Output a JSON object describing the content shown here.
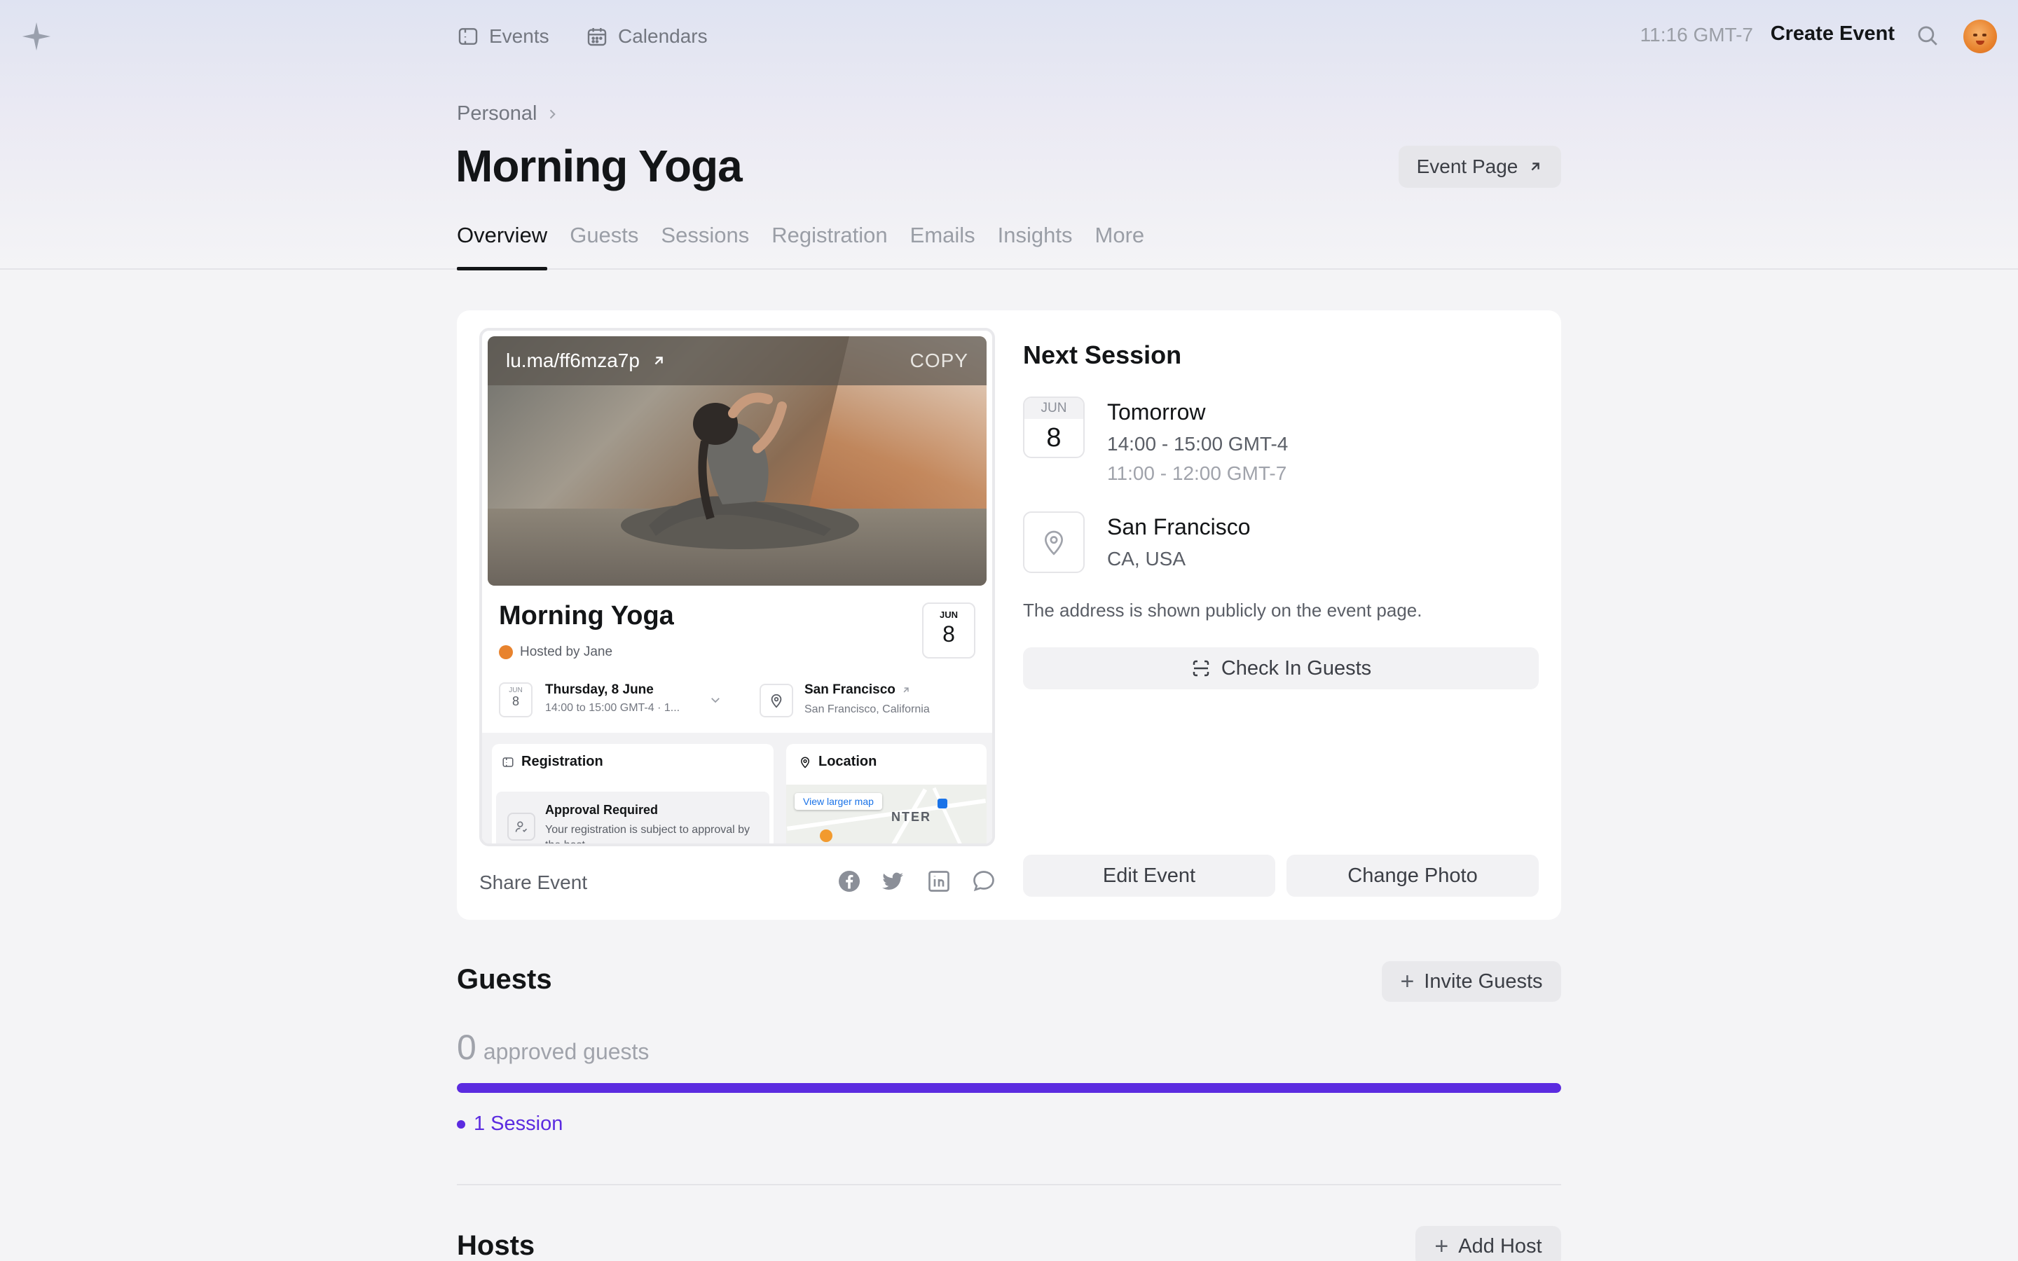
{
  "nav": {
    "events_label": "Events",
    "calendars_label": "Calendars",
    "time": "11:16 GMT-7",
    "create_event_label": "Create Event"
  },
  "header": {
    "breadcrumb": "Personal",
    "title": "Morning Yoga",
    "event_page_label": "Event Page",
    "tabs": [
      {
        "label": "Overview",
        "active": true
      },
      {
        "label": "Guests"
      },
      {
        "label": "Sessions"
      },
      {
        "label": "Registration"
      },
      {
        "label": "Emails"
      },
      {
        "label": "Insights"
      },
      {
        "label": "More"
      }
    ]
  },
  "preview": {
    "link": "lu.ma/ff6mza7p",
    "copy_label": "COPY",
    "title": "Morning Yoga",
    "host": "Hosted by Jane",
    "cal_month": "JUN",
    "cal_day": "8",
    "date_main": "Thursday, 8 June",
    "date_sub": "14:00 to 15:00 GMT-4 · 1...",
    "location_main": "San Francisco",
    "location_sub": "San Francisco, California",
    "registration_head": "Registration",
    "approval_title": "Approval Required",
    "approval_sub": "Your registration is subject to approval by the host.",
    "location_head": "Location",
    "map_button": "View larger map",
    "map_label": "NTER"
  },
  "share": {
    "label": "Share Event",
    "icons": [
      "facebook-icon",
      "twitter-icon",
      "linkedin-icon",
      "message-icon"
    ]
  },
  "next_session": {
    "heading": "Next Session",
    "month": "JUN",
    "day": "8",
    "when": "Tomorrow",
    "time_local": "14:00 - 15:00 GMT-4",
    "time_user": "11:00 - 12:00 GMT-7",
    "city": "San Francisco",
    "region": "CA, USA",
    "note": "The address is shown publicly on the event page.",
    "check_in_label": "Check In Guests",
    "edit_label": "Edit Event",
    "change_photo_label": "Change Photo"
  },
  "guests": {
    "title": "Guests",
    "invite_label": "Invite Guests",
    "count": "0",
    "count_label": "approved guests",
    "progress": 1.0,
    "sessions_label": "1 Session"
  },
  "hosts": {
    "title": "Hosts",
    "add_label": "Add Host"
  },
  "colors": {
    "accent": "#5b2be0",
    "text": "#131517",
    "muted": "#737780"
  }
}
